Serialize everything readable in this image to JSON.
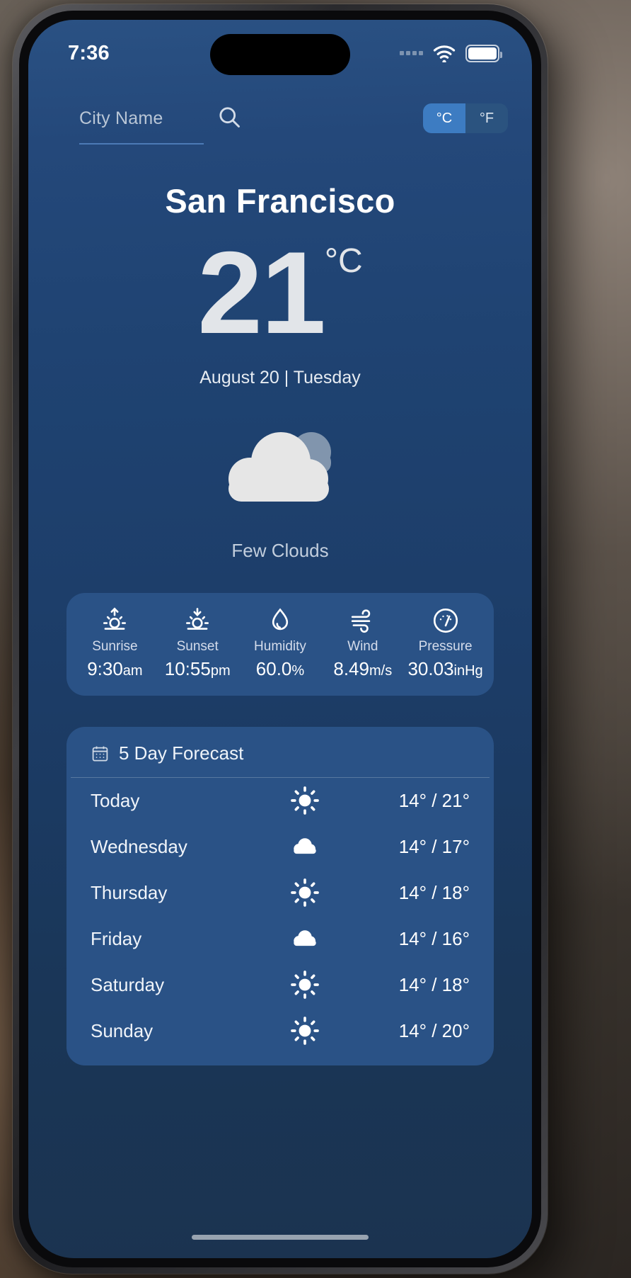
{
  "status_bar": {
    "time": "7:36",
    "wifi_icon": "wifi-icon",
    "battery_icon": "battery-icon",
    "signal_icon": "signal-dots-icon"
  },
  "search": {
    "placeholder": "City Name",
    "value": "",
    "icon": "search-icon"
  },
  "unit_toggle": {
    "celsius_label": "°C",
    "fahrenheit_label": "°F",
    "selected": "°C",
    "active_color": "#3d7cc2",
    "track_color": "#2b537f"
  },
  "current": {
    "city": "San Francisco",
    "temperature": "21",
    "unit": "°C",
    "date": "August 20 | Tuesday",
    "description": "Few Clouds",
    "icon": "few-clouds-icon",
    "cloud_front_color": "#e6e6e6",
    "cloud_back_color": "#8195ad"
  },
  "details": [
    {
      "label": "Sunrise",
      "value": "9:30",
      "unit": "am",
      "icon": "sunrise-icon"
    },
    {
      "label": "Sunset",
      "value": "10:55",
      "unit": "pm",
      "icon": "sunset-icon"
    },
    {
      "label": "Humidity",
      "value": "60.0",
      "unit": "%",
      "icon": "humidity-droplet-icon"
    },
    {
      "label": "Wind",
      "value": "8.49",
      "unit": "m/s",
      "icon": "wind-icon"
    },
    {
      "label": "Pressure",
      "value": "30.03",
      "unit": "inHg",
      "icon": "pressure-gauge-icon"
    }
  ],
  "forecast": {
    "title": "5 Day Forecast",
    "icon": "calendar-icon",
    "rows": [
      {
        "day": "Today",
        "icon": "sun-icon",
        "temps": "14° / 21°"
      },
      {
        "day": "Wednesday",
        "icon": "cloud-icon",
        "temps": "14° / 17°"
      },
      {
        "day": "Thursday",
        "icon": "sun-icon",
        "temps": "14° / 18°"
      },
      {
        "day": "Friday",
        "icon": "cloud-icon",
        "temps": "14° / 16°"
      },
      {
        "day": "Saturday",
        "icon": "sun-icon",
        "temps": "14° / 18°"
      },
      {
        "day": "Sunday",
        "icon": "sun-icon",
        "temps": "14° / 20°"
      }
    ]
  },
  "theme": {
    "screen_bg_top": "#2a5183",
    "screen_bg_bottom": "#1b3350",
    "card_bg": "#2a5286",
    "text_primary": "#ffffff",
    "text_muted": "#c2cedd"
  }
}
